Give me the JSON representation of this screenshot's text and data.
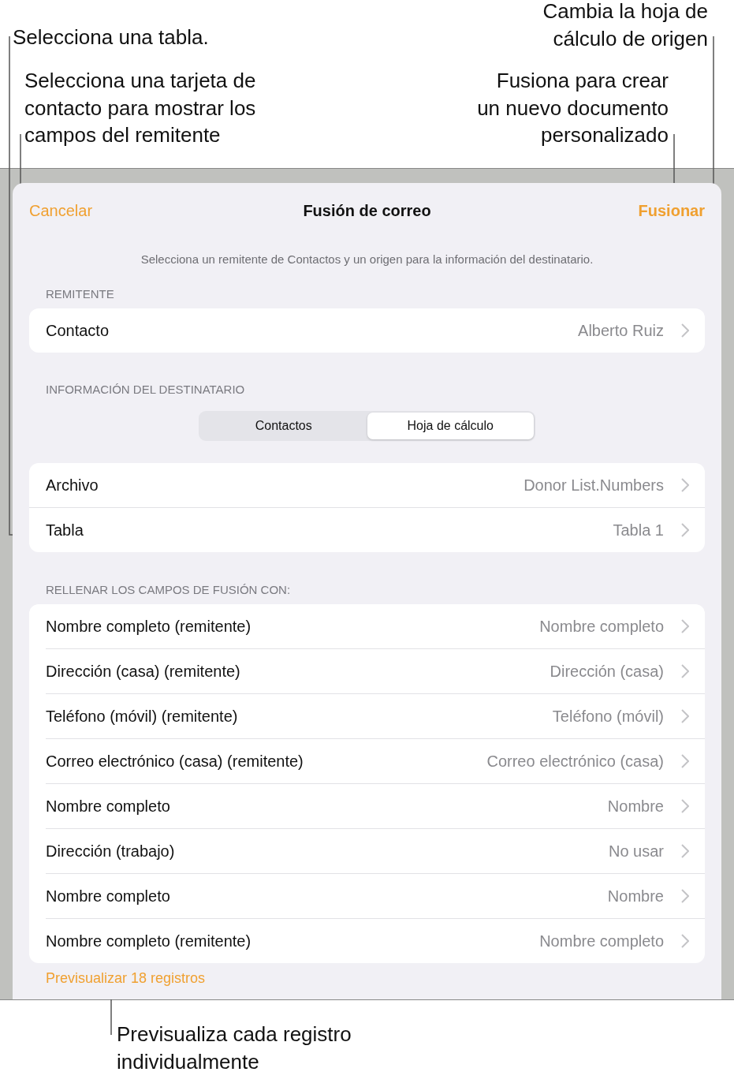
{
  "callouts": [
    {
      "text": "Selecciona una tabla."
    },
    {
      "text": "Selecciona una tarjeta de\ncontacto para mostrar los\ncampos del remitente"
    },
    {
      "text": "Cambia la hoja de\ncálculo de origen"
    },
    {
      "text": "Fusiona para crear\nun nuevo documento\npersonalizado"
    },
    {
      "text": "Previsualiza cada registro\nindividualmente"
    }
  ],
  "sheet": {
    "cancel": "Cancelar",
    "title": "Fusión de correo",
    "confirm": "Fusionar",
    "description": "Selecciona un remitente de Contactos y un origen para la información del destinatario.",
    "sender_header": "REMITENTE",
    "sender_rows": [
      {
        "label": "Contacto",
        "value": "Alberto Ruiz"
      }
    ],
    "recipient_header": "INFORMACIÓN DEL DESTINATARIO",
    "segments": [
      {
        "label": "Contactos",
        "selected": false
      },
      {
        "label": "Hoja de cálculo",
        "selected": true
      }
    ],
    "source_rows": [
      {
        "label": "Archivo",
        "value": "Donor List.Numbers"
      },
      {
        "label": "Tabla",
        "value": "Tabla 1"
      }
    ],
    "fields_header": "RELLENAR LOS CAMPOS DE FUSIÓN CON:",
    "field_rows": [
      {
        "label": "Nombre completo (remitente)",
        "value": "Nombre completo"
      },
      {
        "label": "Dirección (casa) (remitente)",
        "value": "Dirección (casa)"
      },
      {
        "label": "Teléfono (móvil) (remitente)",
        "value": "Teléfono (móvil)"
      },
      {
        "label": "Correo electrónico (casa) (remitente)",
        "value": "Correo electrónico (casa)"
      },
      {
        "label": "Nombre completo",
        "value": "Nombre"
      },
      {
        "label": "Dirección (trabajo)",
        "value": "No usar"
      },
      {
        "label": "Nombre completo",
        "value": "Nombre"
      },
      {
        "label": "Nombre completo (remitente)",
        "value": "Nombre completo"
      }
    ],
    "preview_link": "Previsualizar 18 registros"
  }
}
